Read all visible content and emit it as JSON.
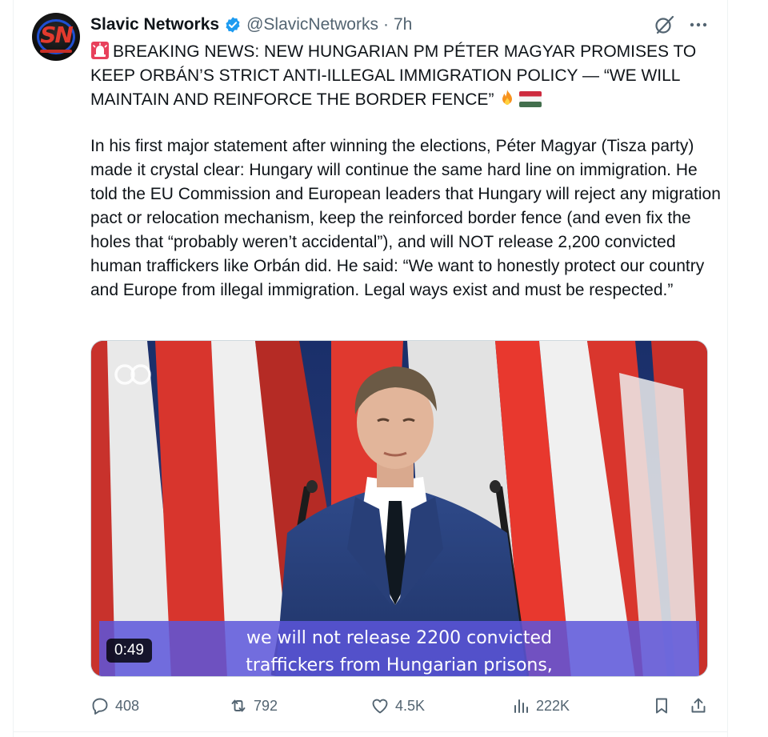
{
  "post": {
    "author": {
      "display_name": "Slavic Networks",
      "handle": "@SlavicNetworks",
      "time_separator": "·",
      "time": "7h",
      "verified": true,
      "avatar_letters": "SN"
    },
    "headline": "BREAKING NEWS: NEW HUNGARIAN PM PÉTER MAGYAR PROMISES TO KEEP ORBÁN’S STRICT ANTI-ILLEGAL IMMIGRATION POLICY — “WE WILL MAINTAIN AND REINFORCE THE BORDER FENCE”",
    "body": "In his first major statement after winning the elections, Péter Magyar (Tisza party) made it crystal clear: Hungary will continue the same hard line on immigration. He told the EU Commission and European leaders that Hungary will reject any migration pact or relocation mechanism, keep the reinforced border fence (and even fix the holes that “probably weren’t accidental”), and will NOT release 2,200 convicted human traffickers like Orbán did. He said: “We want to honestly protect our country and Europe from illegal immigration. Legal ways exist and must be respected.”",
    "icons": {
      "headline_prefix": "siren-emoji",
      "headline_suffix": [
        "fire-emoji",
        "hungary-flag-emoji"
      ],
      "header_right": [
        "grok-icon",
        "more-icon"
      ]
    }
  },
  "video": {
    "subtitle_line1": "we will not release 2200 convicted",
    "subtitle_line2": "traffickers from Hungarian prisons,",
    "timecode": "0:49",
    "watermark_icon": "infinity-logo-icon"
  },
  "actions": {
    "replies": "408",
    "reposts": "792",
    "likes": "4.5K",
    "views": "222K"
  },
  "colors": {
    "text_primary": "#0f1419",
    "text_secondary": "#536471",
    "verified_blue": "#1d9bf0",
    "flag_red": "#cd2a3e",
    "flag_green": "#436f4d",
    "subtitle_band": "#5c56da"
  }
}
